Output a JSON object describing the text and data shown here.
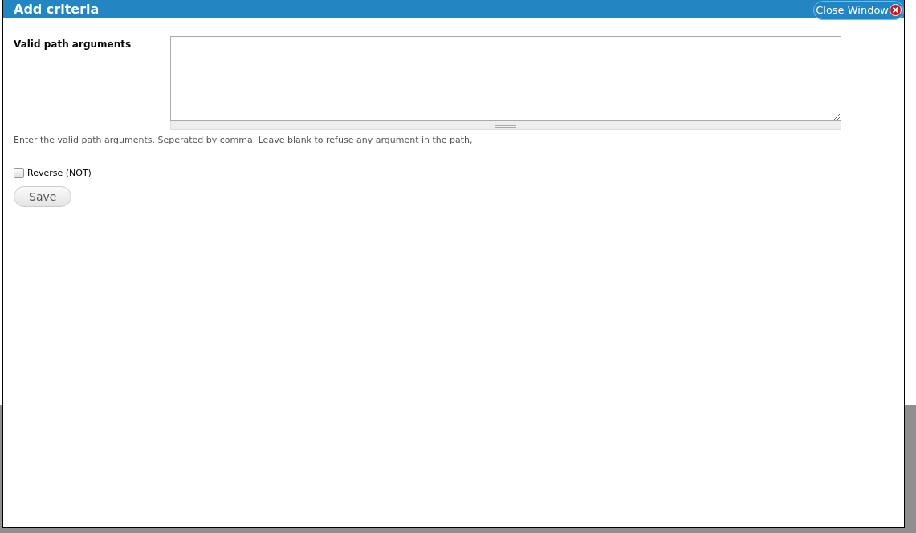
{
  "window": {
    "title": "Add criteria",
    "close_label": "Close Window"
  },
  "field": {
    "label": "Valid path arguments",
    "description": "Enter the valid path arguments. Seperated by comma. Leave blank to refuse any argument in the path,"
  },
  "checkbox": {
    "label": "Reverse (NOT)",
    "checked": false
  },
  "buttons": [
    "Save"
  ]
}
